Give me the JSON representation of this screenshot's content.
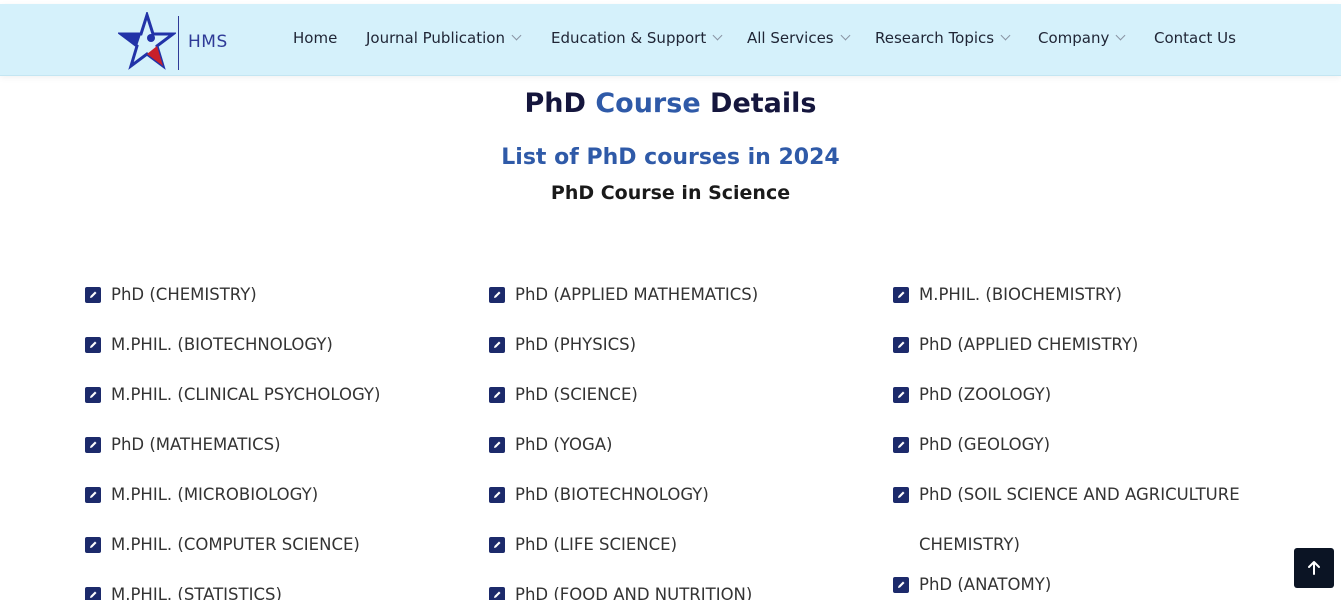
{
  "brand": {
    "name": "HMS"
  },
  "nav": {
    "items": [
      {
        "label": "Home",
        "dropdown": false
      },
      {
        "label": "Journal Publication",
        "dropdown": true
      },
      {
        "label": "Education & Support",
        "dropdown": true
      },
      {
        "label": "All Services",
        "dropdown": true
      },
      {
        "label": "Research Topics",
        "dropdown": true
      },
      {
        "label": "Company",
        "dropdown": true
      },
      {
        "label": "Contact Us",
        "dropdown": false
      }
    ]
  },
  "page": {
    "title_part1": "PhD",
    "title_accent": "Course",
    "title_part3": "Details",
    "subtitle": "List of PhD courses in 2024",
    "section": "PhD Course in Science"
  },
  "courses": {
    "col1": [
      "PhD (CHEMISTRY)",
      "M.PHIL. (BIOTECHNOLOGY)",
      "M.PHIL. (CLINICAL PSYCHOLOGY)",
      "PhD (MATHEMATICS)",
      "M.PHIL. (MICROBIOLOGY)",
      "M.PHIL. (COMPUTER SCIENCE)",
      "M.PHIL. (STATISTICS)"
    ],
    "col2": [
      "PhD (APPLIED MATHEMATICS)",
      "PhD (PHYSICS)",
      "PhD (SCIENCE)",
      "PhD (YOGA)",
      "PhD (BIOTECHNOLOGY)",
      "PhD (LIFE SCIENCE)",
      "PhD (FOOD AND NUTRITION)"
    ],
    "col3": [
      "M.PHIL. (BIOCHEMISTRY)",
      "PhD (APPLIED CHEMISTRY)",
      "PhD (ZOOLOGY)",
      "PhD (GEOLOGY)",
      "PhD (SOIL SCIENCE AND AGRICULTURE CHEMISTRY)",
      "PhD (ANATOMY)"
    ]
  },
  "icons": {
    "course": "edit-icon",
    "back_to_top": "arrow-up-icon"
  },
  "colors": {
    "header_bg": "#d5f1fb",
    "accent": "#2f5aa8",
    "dark": "#15163d",
    "icon_bg": "#1c2a6b"
  }
}
